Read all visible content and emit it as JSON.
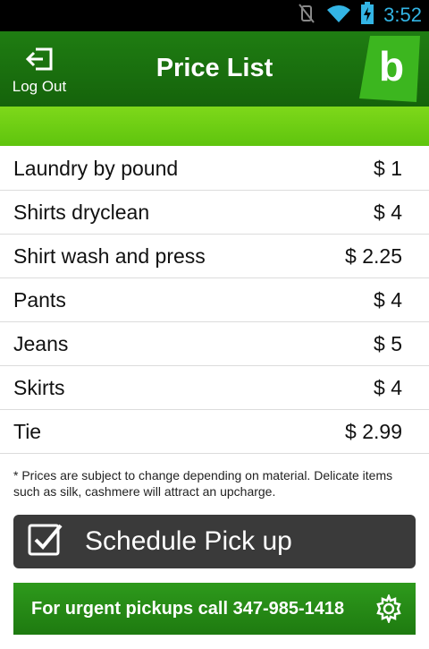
{
  "status": {
    "time": "3:52"
  },
  "header": {
    "title": "Price List",
    "logout_label": "Log Out",
    "brand_letter": "b"
  },
  "items": [
    {
      "name": "Laundry by pound",
      "price": "$ 1"
    },
    {
      "name": "Shirts dryclean",
      "price": "$ 4"
    },
    {
      "name": "Shirt wash and press",
      "price": "$ 2.25"
    },
    {
      "name": "Pants",
      "price": "$ 4"
    },
    {
      "name": "Jeans",
      "price": "$ 5"
    },
    {
      "name": "Skirts",
      "price": "$ 4"
    },
    {
      "name": "Tie",
      "price": "$ 2.99"
    }
  ],
  "note": "* Prices are subject to change depending on material. Delicate items such as silk, cashmere will attract an upcharge.",
  "schedule": {
    "label": "Schedule Pick up"
  },
  "urgent": {
    "label": "For urgent pickups call 347-985-1418"
  },
  "colors": {
    "header": "#1f7d12",
    "band": "#7ed81a",
    "button_dark": "#3a3a3a",
    "status_accent": "#33b5e5"
  }
}
